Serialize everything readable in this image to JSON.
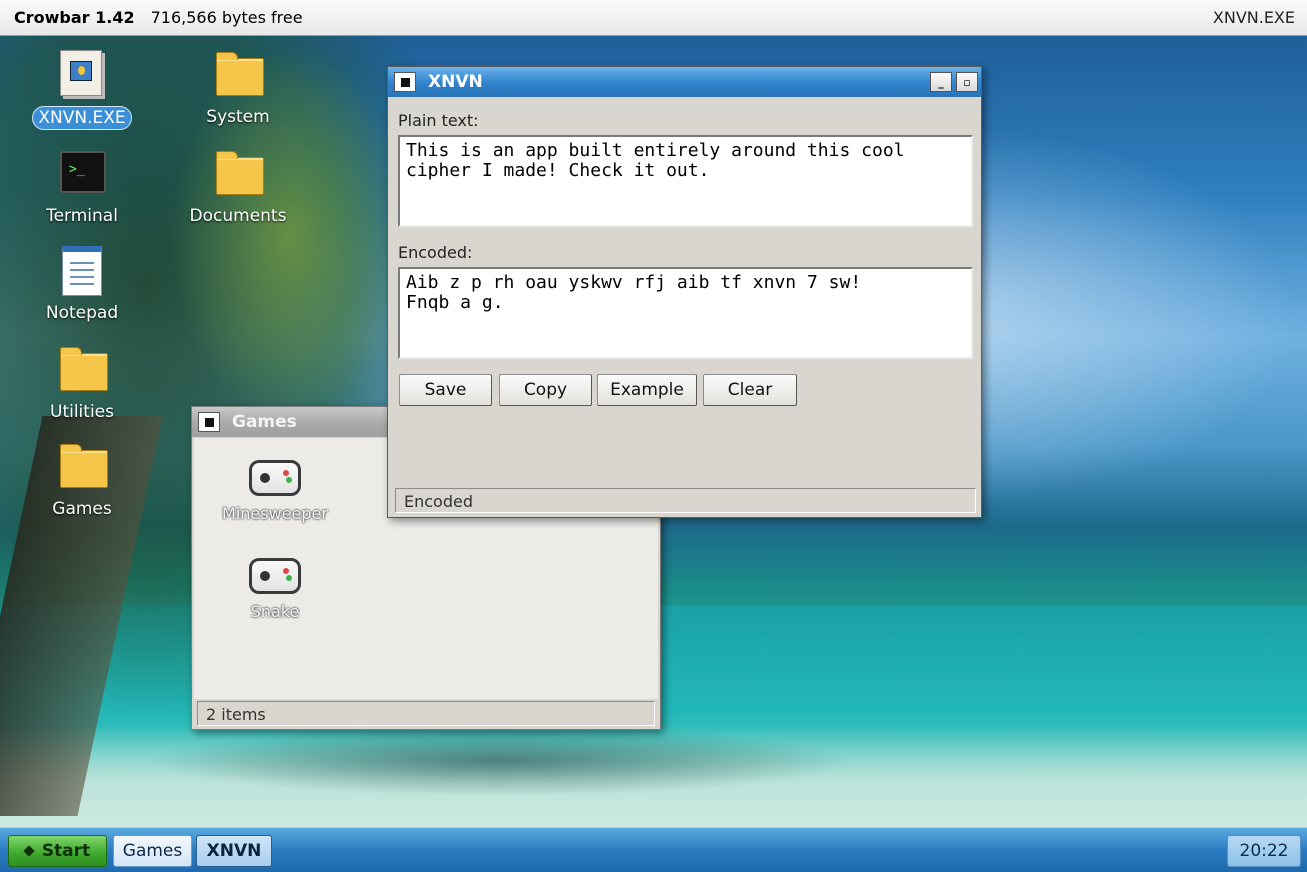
{
  "menubar": {
    "app_name": "Crowbar 1.42",
    "memory": "716,566 bytes free",
    "active_program": "XNVN.EXE"
  },
  "desktop": {
    "icons": [
      {
        "label": "XNVN.EXE",
        "icon": "xnvn-exe-icon"
      },
      {
        "label": "System",
        "icon": "folder-icon"
      },
      {
        "label": "Terminal",
        "icon": "terminal-icon"
      },
      {
        "label": "Documents",
        "icon": "folder-icon"
      },
      {
        "label": "Notepad",
        "icon": "notepad-icon"
      },
      {
        "label": "Utilities",
        "icon": "folder-icon"
      },
      {
        "label": "Games",
        "icon": "folder-icon"
      }
    ],
    "terminal_glyph": ">_"
  },
  "games_window": {
    "title": "Games",
    "items": [
      {
        "label": "Minesweeper",
        "icon": "gamepad-icon"
      },
      {
        "label": "Snake",
        "icon": "gamepad-icon"
      }
    ],
    "status": "2 items"
  },
  "xnvn_window": {
    "title": "XNVN",
    "minimize_glyph": "_",
    "maximize_glyph": "▫",
    "plain_label": "Plain text:",
    "plain_value": "This is an app built entirely around this cool\ncipher I made! Check it out.",
    "encoded_label": "Encoded:",
    "encoded_value": "Aib z p rh oau yskwv rfj aib tf xnvn 7 sw!\nFnqb a g.",
    "buttons": {
      "save": "Save",
      "copy": "Copy",
      "example": "Example",
      "clear": "Clear"
    },
    "status": "Encoded"
  },
  "taskbar": {
    "start_label": "Start",
    "tasks": [
      {
        "label": "Games",
        "active": false
      },
      {
        "label": "XNVN",
        "active": true
      }
    ],
    "clock": "20:22"
  },
  "colors": {
    "titlebar_active": "#2f82cc",
    "titlebar_inactive": "#a9a9a9",
    "start_button": "#3ea72d",
    "selection": "#3a8fd6"
  }
}
